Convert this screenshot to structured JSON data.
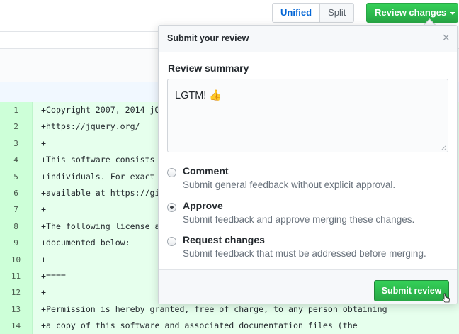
{
  "toolbar": {
    "unified_label": "Unified",
    "split_label": "Split",
    "review_button_label": "Review changes"
  },
  "diff": {
    "rows": [
      {
        "line": "1",
        "code": "+Copyright 2007, 2014 jQ"
      },
      {
        "line": "2",
        "code": "+https://jquery.org/"
      },
      {
        "line": "3",
        "code": "+"
      },
      {
        "line": "4",
        "code": "+This software consists"
      },
      {
        "line": "5",
        "code": "+individuals. For exact"
      },
      {
        "line": "6",
        "code": "+available at https://gi"
      },
      {
        "line": "7",
        "code": "+"
      },
      {
        "line": "8",
        "code": "+The following license a"
      },
      {
        "line": "9",
        "code": "+documented below:"
      },
      {
        "line": "10",
        "code": "+"
      },
      {
        "line": "11",
        "code": "+===="
      },
      {
        "line": "12",
        "code": "+"
      },
      {
        "line": "13",
        "code": "+Permission is hereby granted, free of charge, to any person obtaining"
      },
      {
        "line": "14",
        "code": "+a copy of this software and associated documentation files (the"
      }
    ]
  },
  "review_popover": {
    "title": "Submit your review",
    "close_glyph": "×",
    "summary_label": "Review summary",
    "summary_value": "LGTM! 👍",
    "options": [
      {
        "label": "Comment",
        "description": "Submit general feedback without explicit approval.",
        "checked": false
      },
      {
        "label": "Approve",
        "description": "Submit feedback and approve merging these changes.",
        "checked": true
      },
      {
        "label": "Request changes",
        "description": "Submit feedback that must be addressed before merging.",
        "checked": false
      }
    ],
    "submit_label": "Submit review"
  },
  "colors": {
    "accent_green": "#28a745",
    "link_blue": "#0366d6",
    "diff_added_bg": "#e6ffed",
    "diff_added_gutter": "#cdffd8"
  }
}
